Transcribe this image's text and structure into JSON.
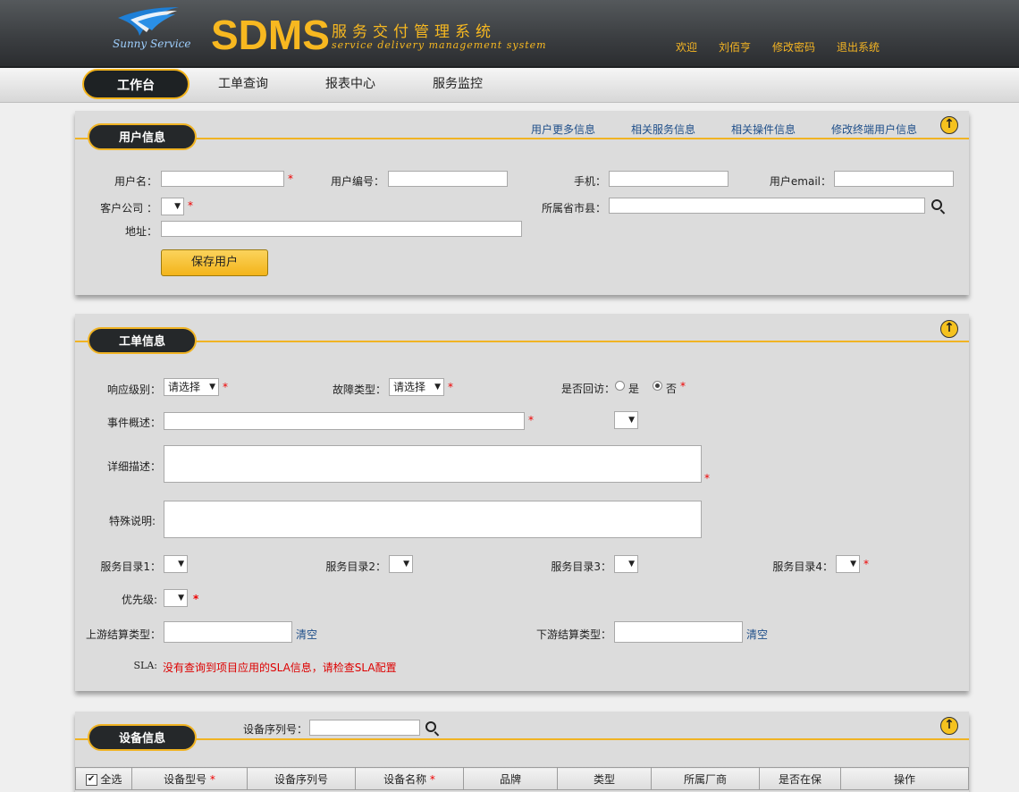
{
  "header": {
    "logo_text": "Sunny Service",
    "app_name": "SDMS",
    "subtitle_cn": "服务交付管理系统",
    "subtitle_en": "service delivery management system",
    "links": {
      "welcome": "欢迎",
      "user": "刘佰亨",
      "change_password": "修改密码",
      "logout": "退出系统"
    },
    "brand_color": "#f5b523"
  },
  "nav": {
    "tabs": [
      {
        "label": "工作台",
        "active": true
      },
      {
        "label": "工单查询"
      },
      {
        "label": "报表中心"
      },
      {
        "label": "服务监控"
      }
    ]
  },
  "user_panel": {
    "title": "用户信息",
    "links": [
      "用户更多信息",
      "相关服务信息",
      "相关操件信息",
      "修改终端用户信息"
    ],
    "fields": {
      "username": {
        "label": "用户名：",
        "value": ""
      },
      "user_no": {
        "label": "用户编号：",
        "value": ""
      },
      "phone": {
        "label": "手机：",
        "value": ""
      },
      "email": {
        "label": "用户email：",
        "value": ""
      },
      "company": {
        "label": "客户公司 ：",
        "value": ""
      },
      "region": {
        "label": "所属省市县：",
        "value": ""
      },
      "address": {
        "label": "地址：",
        "value": ""
      }
    },
    "required_mark": "*",
    "save_button": "保存用户"
  },
  "ticket_panel": {
    "title": "工单信息",
    "response_level": {
      "label": "响应级别：",
      "value": "请选择"
    },
    "fault_type": {
      "label": "故障类型：",
      "value": "请选择"
    },
    "revisit": {
      "label": "是否回访：",
      "options": [
        "是",
        "否"
      ],
      "selected": "否"
    },
    "summary": {
      "label": "事件概述：",
      "value": ""
    },
    "detail": {
      "label": "详细描述：",
      "value": ""
    },
    "special": {
      "label": "特殊说明:",
      "value": ""
    },
    "catalogs": [
      "服务目录1：",
      "服务目录2：",
      "服务目录3：",
      "服务目录4："
    ],
    "priority": {
      "label": "优先级:"
    },
    "upstream": {
      "label": "上游结算类型：",
      "clear": "清空",
      "value": ""
    },
    "downstream": {
      "label": "下游结算类型：",
      "clear": "清空",
      "value": ""
    },
    "sla": {
      "label": "SLA:",
      "message": "没有查询到项目应用的SLA信息，请检查SLA配置"
    }
  },
  "device_panel": {
    "title": "设备信息",
    "serial_search": {
      "label": "设备序列号：",
      "value": ""
    },
    "table_headers": [
      "全选",
      "设备型号",
      "设备序列号",
      "设备名称",
      "品牌",
      "类型",
      "所属厂商",
      "是否在保",
      "操作"
    ]
  },
  "icons": {
    "up": "arrow-up-circle-icon",
    "search": "search-icon",
    "logo": "swoosh-logo-icon"
  }
}
